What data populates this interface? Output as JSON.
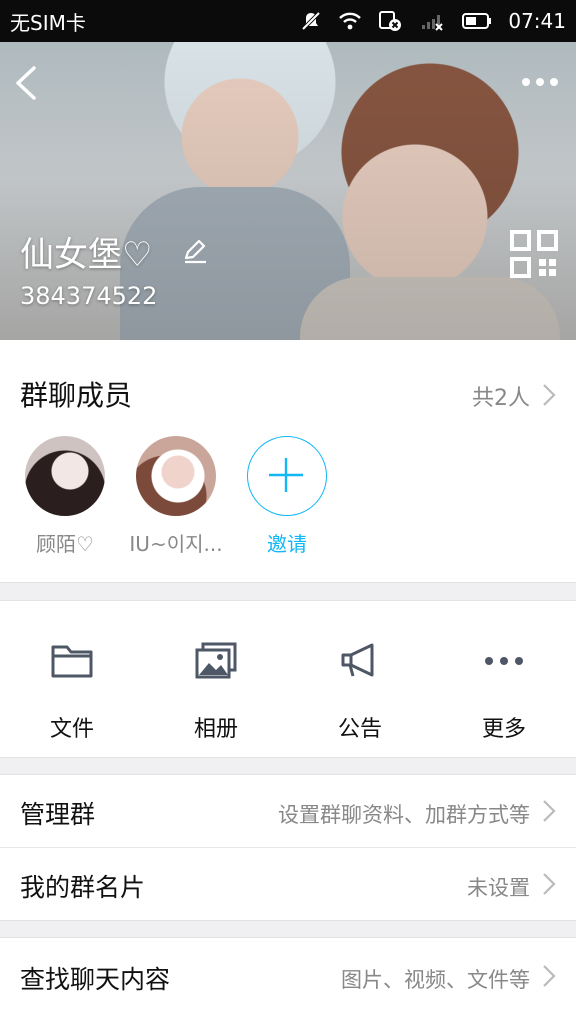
{
  "status_bar": {
    "carrier": "无SIM卡",
    "time": "07:41",
    "icons": [
      "mute-icon",
      "wifi-icon",
      "sim-missing-icon",
      "signal-icon",
      "battery-icon"
    ]
  },
  "header": {
    "group_name": "仙女堡♡",
    "group_id": "384374522",
    "icons": [
      "back-icon",
      "more-icon",
      "edit-icon",
      "qr-code-icon"
    ]
  },
  "members": {
    "title": "群聊成员",
    "count": "共2人",
    "list": [
      {
        "name": "顾陌♡"
      },
      {
        "name": "IU~이지..."
      }
    ],
    "invite_label": "邀请"
  },
  "quick_actions": [
    {
      "label": "文件",
      "icon": "folder-icon"
    },
    {
      "label": "相册",
      "icon": "album-icon"
    },
    {
      "label": "公告",
      "icon": "announcement-icon"
    },
    {
      "label": "更多",
      "icon": "more-dots-icon"
    }
  ],
  "settings_group1": [
    {
      "title": "管理群",
      "value": "设置群聊资料、加群方式等"
    },
    {
      "title": "我的群名片",
      "value": "未设置"
    }
  ],
  "settings_group2": [
    {
      "title": "查找聊天内容",
      "value": "图片、视频、文件等"
    }
  ],
  "colors": {
    "accent": "#12b7f5",
    "secondary_text": "#888888",
    "background": "#f0f0f2"
  }
}
